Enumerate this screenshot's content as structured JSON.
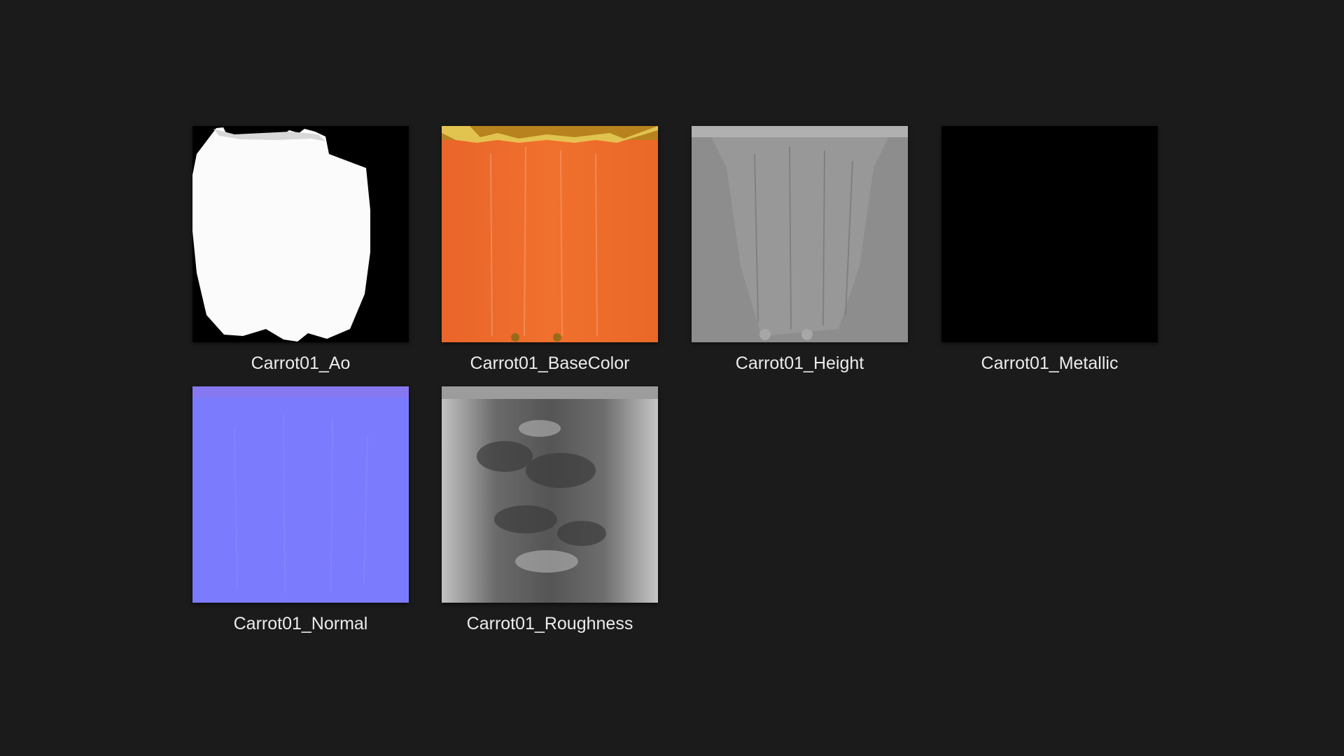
{
  "files": [
    {
      "name": "Carrot01_Ao",
      "thumbnail": "ambient-occlusion-map"
    },
    {
      "name": "Carrot01_BaseColor",
      "thumbnail": "base-color-map"
    },
    {
      "name": "Carrot01_Height",
      "thumbnail": "height-map"
    },
    {
      "name": "Carrot01_Metallic",
      "thumbnail": "metallic-map"
    },
    {
      "name": "Carrot01_Normal",
      "thumbnail": "normal-map"
    },
    {
      "name": "Carrot01_Roughness",
      "thumbnail": "roughness-map"
    }
  ],
  "colors": {
    "background": "#1b1b1b",
    "label_text": "#ececec",
    "base_color_orange": "#ee6b2a",
    "normal_blue": "#7c7cff",
    "metallic_black": "#000000"
  }
}
